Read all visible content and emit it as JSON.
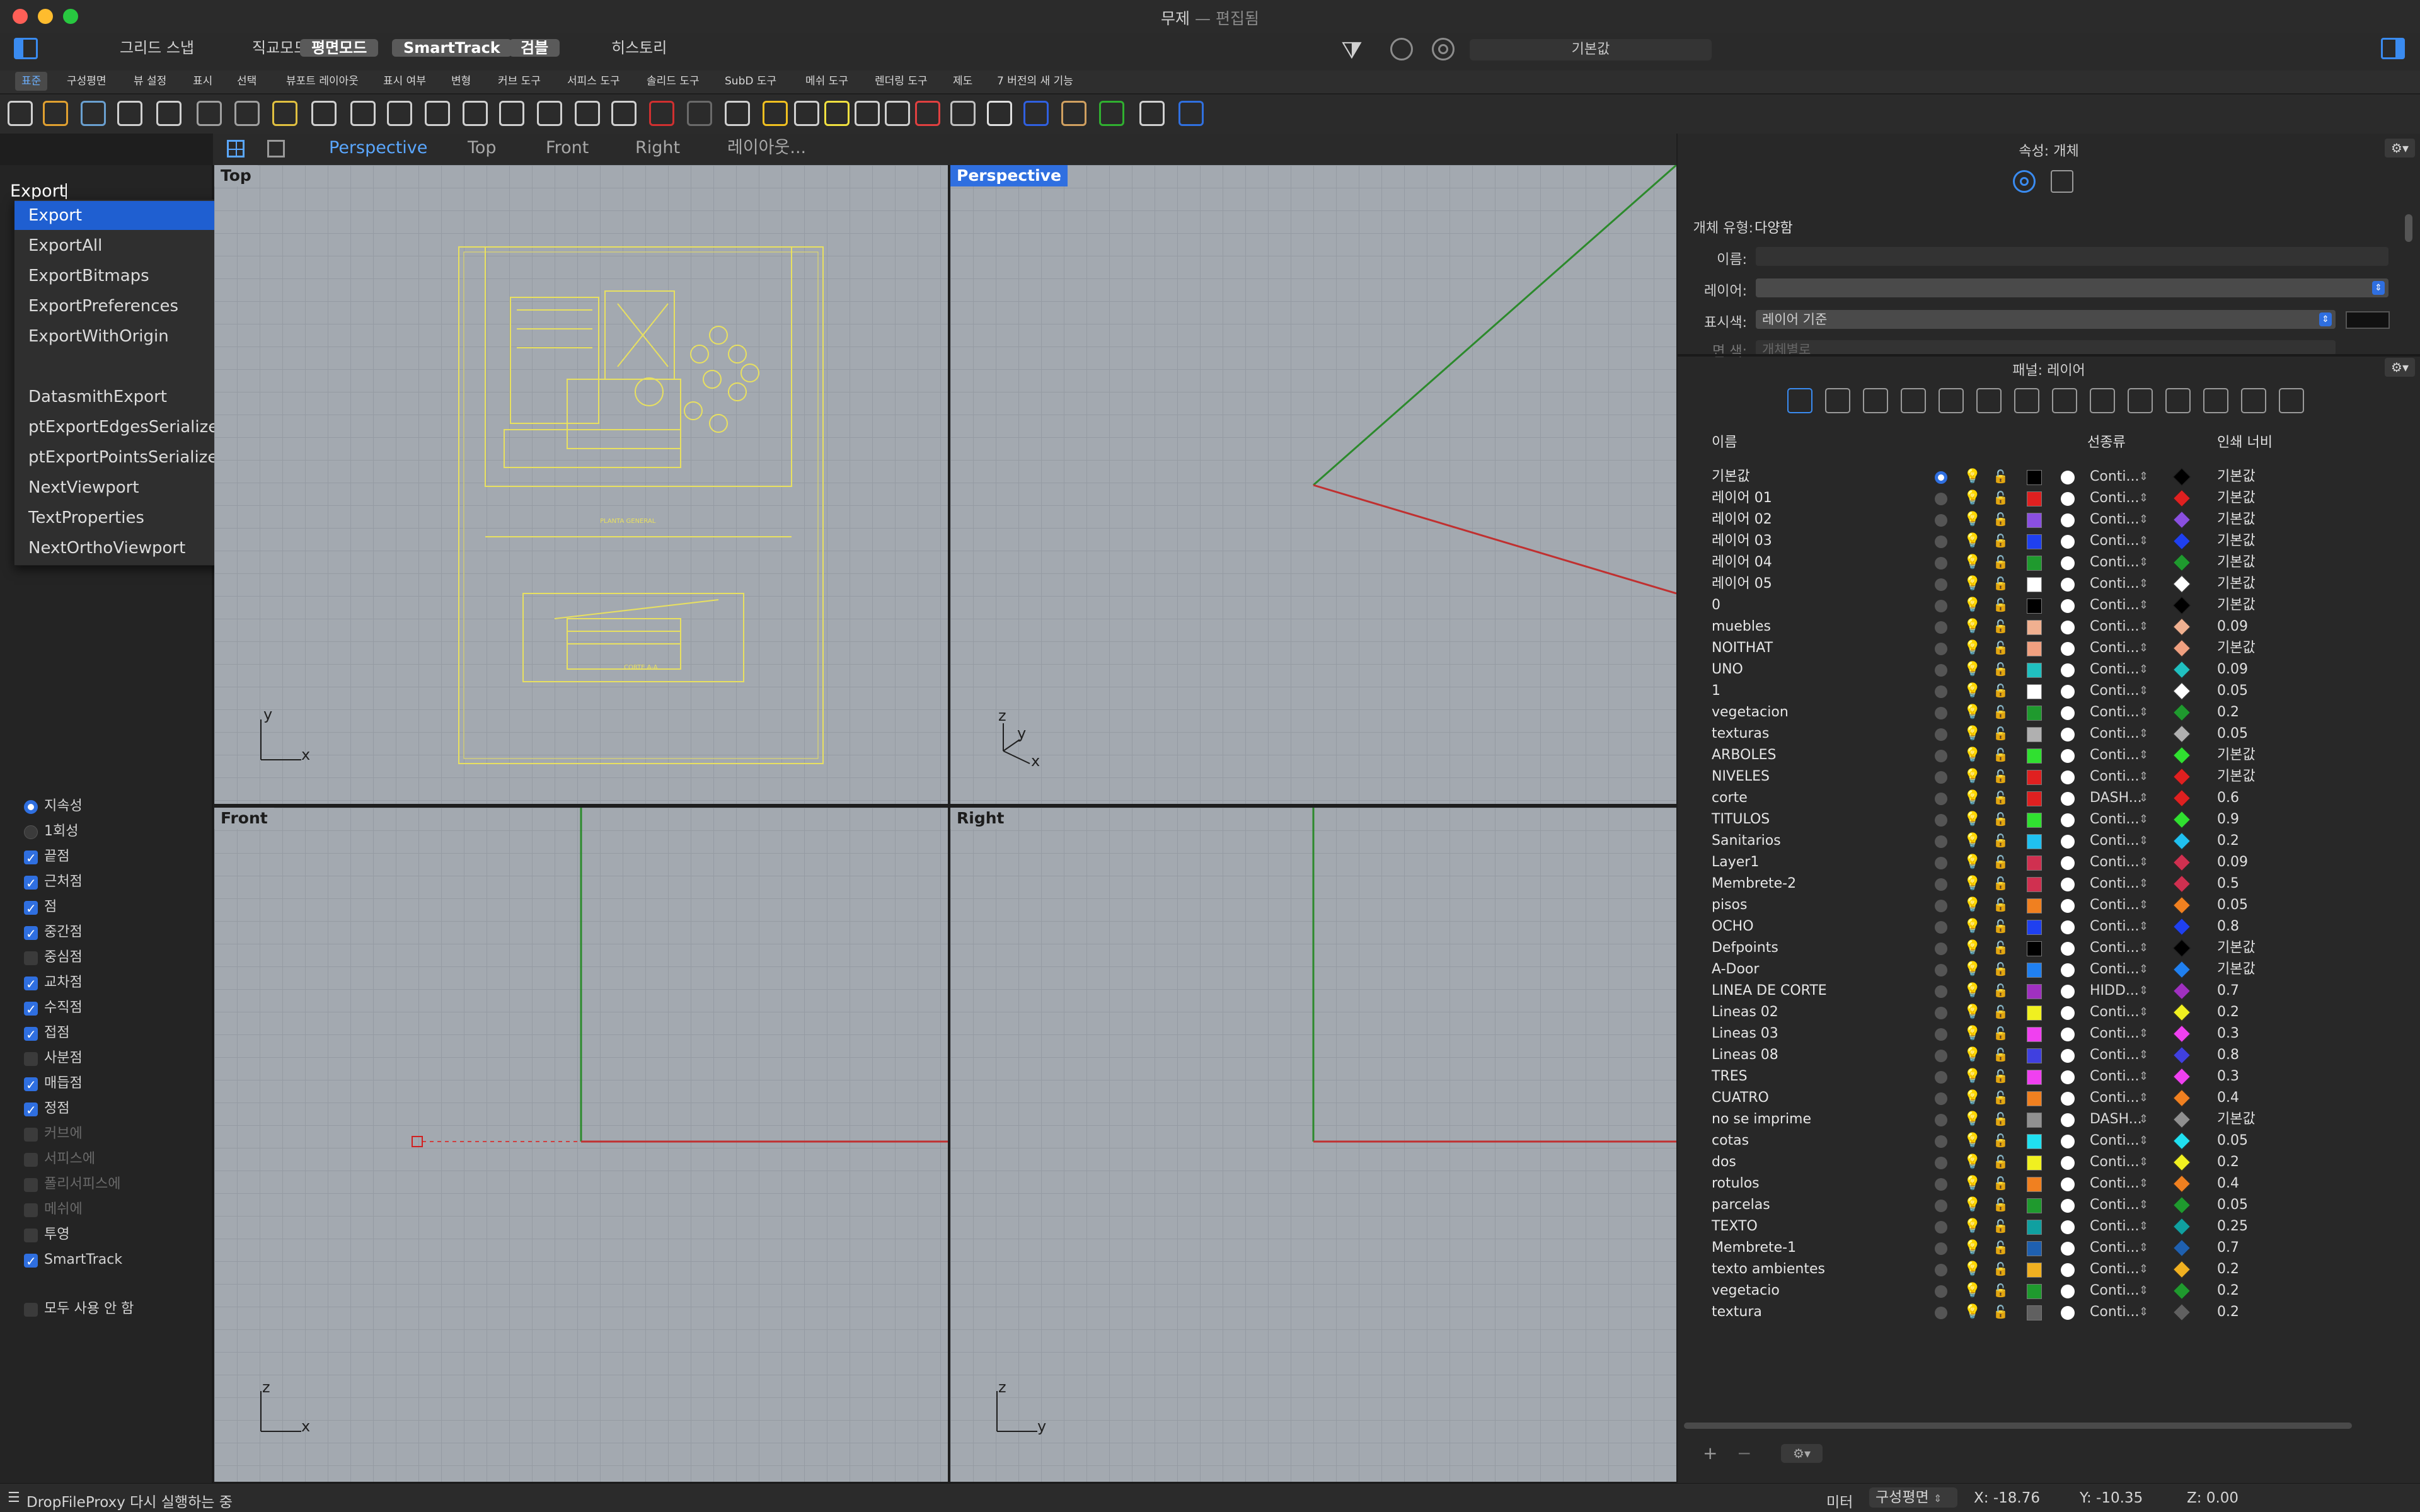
{
  "window": {
    "title": "무제",
    "subtitle": "— 편집됨"
  },
  "osnap_bar": {
    "buttons": [
      {
        "label": "그리드 스냅",
        "on": false
      },
      {
        "label": "직교모드",
        "on": false
      },
      {
        "label": "평면모드",
        "on": true
      },
      {
        "label": "SmartTrack",
        "on": true
      },
      {
        "label": "검블",
        "on": true
      },
      {
        "label": "히스토리",
        "on": false
      }
    ],
    "layer_value": "기본값"
  },
  "toolbar_tabs": [
    "표준",
    "구성평면",
    "뷰 설정",
    "표시",
    "선택",
    "뷰포트 레이아웃",
    "표시 여부",
    "변형",
    "커브 도구",
    "서피스 도구",
    "솔리드 도구",
    "SubD 도구",
    "메쉬 도구",
    "렌더링 도구",
    "제도",
    "7 버전의 새 기능"
  ],
  "viewport_tabs": [
    "Perspective",
    "Top",
    "Front",
    "Right",
    "레이아웃..."
  ],
  "command": {
    "input": "Export",
    "suggestions": [
      "Export",
      "ExportAll",
      "ExportBitmaps",
      "ExportPreferences",
      "ExportWithOrigin",
      "",
      "DatasmithExport",
      "ptExportEdgesSerializeData",
      "ptExportPointsSerializeData",
      "NextViewport",
      "TextProperties",
      "NextOrthoViewport"
    ]
  },
  "osnaps": [
    {
      "label": "지속성",
      "type": "radio",
      "on": true,
      "dim": false
    },
    {
      "label": "1회성",
      "type": "radio",
      "on": false,
      "dim": false
    },
    {
      "label": "끝점",
      "type": "check",
      "on": true,
      "dim": false
    },
    {
      "label": "근처점",
      "type": "check",
      "on": true,
      "dim": false
    },
    {
      "label": "점",
      "type": "check",
      "on": true,
      "dim": false
    },
    {
      "label": "중간점",
      "type": "check",
      "on": true,
      "dim": false
    },
    {
      "label": "중심점",
      "type": "check",
      "on": false,
      "dim": false
    },
    {
      "label": "교차점",
      "type": "check",
      "on": true,
      "dim": false
    },
    {
      "label": "수직점",
      "type": "check",
      "on": true,
      "dim": false
    },
    {
      "label": "접점",
      "type": "check",
      "on": true,
      "dim": false
    },
    {
      "label": "사분점",
      "type": "check",
      "on": false,
      "dim": false
    },
    {
      "label": "매듭점",
      "type": "check",
      "on": true,
      "dim": false
    },
    {
      "label": "정점",
      "type": "check",
      "on": true,
      "dim": false
    },
    {
      "label": "커브에",
      "type": "check",
      "on": false,
      "dim": true
    },
    {
      "label": "서피스에",
      "type": "check",
      "on": false,
      "dim": true
    },
    {
      "label": "폴리서피스에",
      "type": "check",
      "on": false,
      "dim": true
    },
    {
      "label": "메쉬에",
      "type": "check",
      "on": false,
      "dim": true
    },
    {
      "label": "투영",
      "type": "check",
      "on": false,
      "dim": false
    },
    {
      "label": "SmartTrack",
      "type": "check",
      "on": true,
      "dim": false
    }
  ],
  "disable_all": "모두 사용 안 함",
  "viewports": {
    "top": "Top",
    "perspective": "Perspective",
    "front": "Front",
    "right": "Right"
  },
  "axes": {
    "x": "x",
    "y": "y",
    "z": "z"
  },
  "drawing": {
    "title1": "PLANTA GENERAL",
    "title2": "CORTE A-A"
  },
  "properties": {
    "title": "속성: 개체",
    "type_label": "개체 유형:",
    "type_value": "다양함",
    "name_label": "이름:",
    "layer_label": "레이어:",
    "display_color_label": "표시색:",
    "display_color_value": "레이어 기준",
    "material_label": "면 색:",
    "material_value": "개체별로"
  },
  "layers_panel": {
    "title": "패널: 레이어",
    "col_name": "이름",
    "col_linetype": "선종류",
    "col_printwidth": "인쇄 너비"
  },
  "layers": [
    {
      "name": "기본값",
      "color": "#000000",
      "linetype": "Conti...",
      "print_color": "#000000",
      "print_width": "기본값",
      "current": true
    },
    {
      "name": "레이어 01",
      "color": "#e02020",
      "linetype": "Conti...",
      "print_color": "#e02020",
      "print_width": "기본값",
      "current": false
    },
    {
      "name": "레이어 02",
      "color": "#8a4fe0",
      "linetype": "Conti...",
      "print_color": "#8a4fe0",
      "print_width": "기본값",
      "current": false
    },
    {
      "name": "레이어 03",
      "color": "#1f40f0",
      "linetype": "Conti...",
      "print_color": "#1f40f0",
      "print_width": "기본값",
      "current": false
    },
    {
      "name": "레이어 04",
      "color": "#1f9a2e",
      "linetype": "Conti...",
      "print_color": "#1f9a2e",
      "print_width": "기본값",
      "current": false
    },
    {
      "name": "레이어 05",
      "color": "#ffffff",
      "linetype": "Conti...",
      "print_color": "#ffffff",
      "print_width": "기본값",
      "current": false
    },
    {
      "name": "0",
      "color": "#000000",
      "linetype": "Conti...",
      "print_color": "#000000",
      "print_width": "기본값",
      "current": false
    },
    {
      "name": "muebles",
      "color": "#f0b090",
      "linetype": "Conti...",
      "print_color": "#f0b090",
      "print_width": "0.09",
      "current": false
    },
    {
      "name": "NOITHAT",
      "color": "#f0a080",
      "linetype": "Conti...",
      "print_color": "#f0a080",
      "print_width": "기본값",
      "current": false
    },
    {
      "name": "UNO",
      "color": "#20c0c0",
      "linetype": "Conti...",
      "print_color": "#20c0c0",
      "print_width": "0.09",
      "current": false
    },
    {
      "name": "1",
      "color": "#ffffff",
      "linetype": "Conti...",
      "print_color": "#ffffff",
      "print_width": "0.05",
      "current": false
    },
    {
      "name": "vegetacion",
      "color": "#1f9a2e",
      "linetype": "Conti...",
      "print_color": "#1f9a2e",
      "print_width": "0.2",
      "current": false
    },
    {
      "name": "texturas",
      "color": "#b0b0b0",
      "linetype": "Conti...",
      "print_color": "#b0b0b0",
      "print_width": "0.05",
      "current": false
    },
    {
      "name": "ARBOLES",
      "color": "#30e030",
      "linetype": "Conti...",
      "print_color": "#30e030",
      "print_width": "기본값",
      "current": false
    },
    {
      "name": "NIVELES",
      "color": "#e02020",
      "linetype": "Conti...",
      "print_color": "#e02020",
      "print_width": "기본값",
      "current": false
    },
    {
      "name": "corte",
      "color": "#e02020",
      "linetype": "DASH...",
      "print_color": "#e02020",
      "print_width": "0.6",
      "current": false
    },
    {
      "name": "TITULOS",
      "color": "#30e030",
      "linetype": "Conti...",
      "print_color": "#30e030",
      "print_width": "0.9",
      "current": false
    },
    {
      "name": "Sanitarios",
      "color": "#20c0f0",
      "linetype": "Conti...",
      "print_color": "#20c0f0",
      "print_width": "0.2",
      "current": false
    },
    {
      "name": "Layer1",
      "color": "#d03050",
      "linetype": "Conti...",
      "print_color": "#d03050",
      "print_width": "0.09",
      "current": false
    },
    {
      "name": "Membrete-2",
      "color": "#d03050",
      "linetype": "Conti...",
      "print_color": "#d03050",
      "print_width": "0.5",
      "current": false
    },
    {
      "name": "pisos",
      "color": "#f08020",
      "linetype": "Conti...",
      "print_color": "#f08020",
      "print_width": "0.05",
      "current": false
    },
    {
      "name": "OCHO",
      "color": "#1f40f0",
      "linetype": "Conti...",
      "print_color": "#1f40f0",
      "print_width": "0.8",
      "current": false
    },
    {
      "name": "Defpoints",
      "color": "#000000",
      "linetype": "Conti...",
      "print_color": "#000000",
      "print_width": "기본값",
      "current": false
    },
    {
      "name": "A-Door",
      "color": "#2080f0",
      "linetype": "Conti...",
      "print_color": "#2080f0",
      "print_width": "기본값",
      "current": false
    },
    {
      "name": "LINEA DE CORTE",
      "color": "#a030c0",
      "linetype": "HIDD...",
      "print_color": "#a030c0",
      "print_width": "0.7",
      "current": false
    },
    {
      "name": "Lineas 02",
      "color": "#f0f020",
      "linetype": "Conti...",
      "print_color": "#f0f020",
      "print_width": "0.2",
      "current": false
    },
    {
      "name": "Lineas 03",
      "color": "#f040f0",
      "linetype": "Conti...",
      "print_color": "#f040f0",
      "print_width": "0.3",
      "current": false
    },
    {
      "name": "Lineas 08",
      "color": "#4040e0",
      "linetype": "Conti...",
      "print_color": "#4040e0",
      "print_width": "0.8",
      "current": false
    },
    {
      "name": "TRES",
      "color": "#f040f0",
      "linetype": "Conti...",
      "print_color": "#f040f0",
      "print_width": "0.3",
      "current": false
    },
    {
      "name": "CUATRO",
      "color": "#f08020",
      "linetype": "Conti...",
      "print_color": "#f08020",
      "print_width": "0.4",
      "current": false
    },
    {
      "name": "no se imprime",
      "color": "#909090",
      "linetype": "DASH...",
      "print_color": "#909090",
      "print_width": "기본값",
      "current": false
    },
    {
      "name": "cotas",
      "color": "#20e0f0",
      "linetype": "Conti...",
      "print_color": "#20e0f0",
      "print_width": "0.05",
      "current": false
    },
    {
      "name": "dos",
      "color": "#f0f020",
      "linetype": "Conti...",
      "print_color": "#f0f020",
      "print_width": "0.2",
      "current": false
    },
    {
      "name": "rotulos",
      "color": "#f08020",
      "linetype": "Conti...",
      "print_color": "#f08020",
      "print_width": "0.4",
      "current": false
    },
    {
      "name": "parcelas",
      "color": "#1f9a2e",
      "linetype": "Conti...",
      "print_color": "#1f9a2e",
      "print_width": "0.05",
      "current": false
    },
    {
      "name": "TEXTO",
      "color": "#10a0a0",
      "linetype": "Conti...",
      "print_color": "#10a0a0",
      "print_width": "0.25",
      "current": false
    },
    {
      "name": "Membrete-1",
      "color": "#1f60b0",
      "linetype": "Conti...",
      "print_color": "#1f60b0",
      "print_width": "0.7",
      "current": false
    },
    {
      "name": "texto ambientes",
      "color": "#f0b020",
      "linetype": "Conti...",
      "print_color": "#f0b020",
      "print_width": "0.2",
      "current": false
    },
    {
      "name": "vegetacio",
      "color": "#1f9a2e",
      "linetype": "Conti...",
      "print_color": "#1f9a2e",
      "print_width": "0.2",
      "current": false
    },
    {
      "name": "textura",
      "color": "#606060",
      "linetype": "Conti...",
      "print_color": "#606060",
      "print_width": "0.2",
      "current": false
    }
  ],
  "status": {
    "message": "DropFileProxy 다시 실행하는 중",
    "units": "미터",
    "cplane": "구성평면",
    "x": "X: -18.76",
    "y": "Y: -10.35",
    "z": "Z: 0.00"
  },
  "colors": {
    "accent": "#2f6fe0",
    "viewport_bg": "#a3a9b0"
  }
}
